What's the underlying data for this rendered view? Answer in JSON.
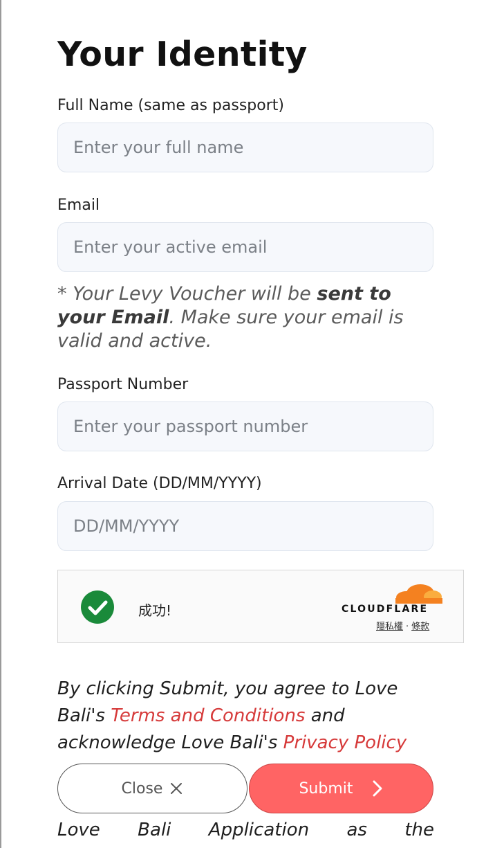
{
  "page": {
    "title": "Your Identity"
  },
  "form": {
    "full_name": {
      "label": "Full Name (same as passport)",
      "placeholder": "Enter your full name",
      "value": ""
    },
    "email": {
      "label": "Email",
      "placeholder": "Enter your active email",
      "value": ""
    },
    "email_note": {
      "prefix": "* Your Levy Voucher will be ",
      "emphasis": "sent to your Email",
      "suffix": ". Make sure your email is valid and active."
    },
    "passport": {
      "label": "Passport Number",
      "placeholder": "Enter your passport number",
      "value": ""
    },
    "arrival_date": {
      "label": "Arrival Date (DD/MM/YYYY)",
      "placeholder": "DD/MM/YYYY",
      "value": ""
    }
  },
  "captcha": {
    "status_text": "成功!",
    "brand": "CLOUDFLARE",
    "privacy_link": "隱私權",
    "separator": "·",
    "terms_link": "條款",
    "check_icon": "check-icon",
    "success_color": "#1a8a3a",
    "brand_color": "#f48120"
  },
  "legal": {
    "part1": "By clicking Submit, you agree to Love Bali's ",
    "terms_link": "Terms and Conditions",
    "part2": " and acknowledge Love Bali's ",
    "privacy_link": "Privacy Policy",
    "link_color": "#d63a3a"
  },
  "actions": {
    "close_label": "Close",
    "close_icon": "close-icon",
    "submit_label": "Submit",
    "submit_icon": "chevron-right-icon",
    "submit_color": "#ff6464"
  },
  "footer": {
    "words": [
      "Love",
      "Bali",
      "Application",
      "as",
      "the"
    ]
  }
}
